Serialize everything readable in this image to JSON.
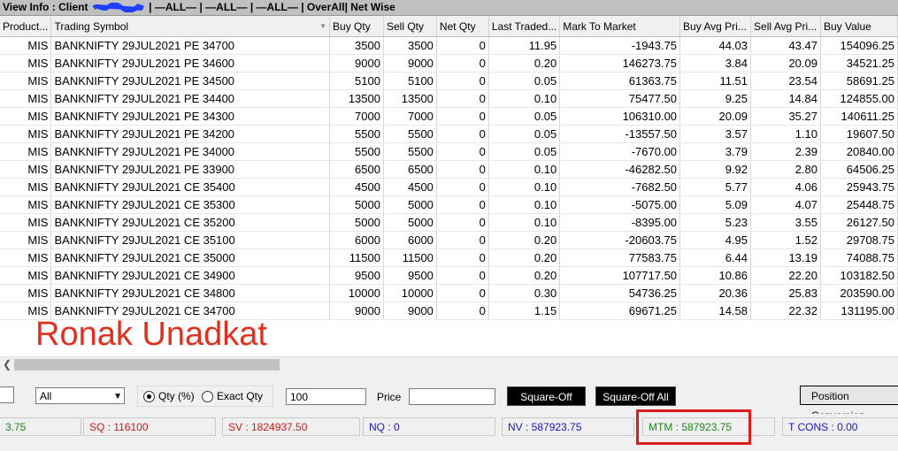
{
  "view_info": {
    "label": "View Info : Client",
    "rest": "| —ALL— | —ALL— | —ALL— | OverAll| Net Wise"
  },
  "columns": [
    "Product...",
    "Trading Symbol",
    "Buy Qty",
    "Sell Qty",
    "Net Qty",
    "Last Traded...",
    "Mark To Market",
    "Buy Avg Pri...",
    "Sell Avg Pri...",
    "Buy Value"
  ],
  "rows": [
    [
      "MIS",
      "BANKNIFTY 29JUL2021 PE 34700",
      "3500",
      "3500",
      "0",
      "11.95",
      "-1943.75",
      "44.03",
      "43.47",
      "154096.25"
    ],
    [
      "MIS",
      "BANKNIFTY 29JUL2021 PE 34600",
      "9000",
      "9000",
      "0",
      "0.20",
      "146273.75",
      "3.84",
      "20.09",
      "34521.25"
    ],
    [
      "MIS",
      "BANKNIFTY 29JUL2021 PE 34500",
      "5100",
      "5100",
      "0",
      "0.05",
      "61363.75",
      "11.51",
      "23.54",
      "58691.25"
    ],
    [
      "MIS",
      "BANKNIFTY 29JUL2021 PE 34400",
      "13500",
      "13500",
      "0",
      "0.10",
      "75477.50",
      "9.25",
      "14.84",
      "124855.00"
    ],
    [
      "MIS",
      "BANKNIFTY 29JUL2021 PE 34300",
      "7000",
      "7000",
      "0",
      "0.05",
      "106310.00",
      "20.09",
      "35.27",
      "140611.25"
    ],
    [
      "MIS",
      "BANKNIFTY 29JUL2021 PE 34200",
      "5500",
      "5500",
      "0",
      "0.05",
      "-13557.50",
      "3.57",
      "1.10",
      "19607.50"
    ],
    [
      "MIS",
      "BANKNIFTY 29JUL2021 PE 34000",
      "5500",
      "5500",
      "0",
      "0.05",
      "-7670.00",
      "3.79",
      "2.39",
      "20840.00"
    ],
    [
      "MIS",
      "BANKNIFTY 29JUL2021 PE 33900",
      "6500",
      "6500",
      "0",
      "0.10",
      "-46282.50",
      "9.92",
      "2.80",
      "64506.25"
    ],
    [
      "MIS",
      "BANKNIFTY 29JUL2021 CE 35400",
      "4500",
      "4500",
      "0",
      "0.10",
      "-7682.50",
      "5.77",
      "4.06",
      "25943.75"
    ],
    [
      "MIS",
      "BANKNIFTY 29JUL2021 CE 35300",
      "5000",
      "5000",
      "0",
      "0.10",
      "-5075.00",
      "5.09",
      "4.07",
      "25448.75"
    ],
    [
      "MIS",
      "BANKNIFTY 29JUL2021 CE 35200",
      "5000",
      "5000",
      "0",
      "0.10",
      "-8395.00",
      "5.23",
      "3.55",
      "26127.50"
    ],
    [
      "MIS",
      "BANKNIFTY 29JUL2021 CE 35100",
      "6000",
      "6000",
      "0",
      "0.20",
      "-20603.75",
      "4.95",
      "1.52",
      "29708.75"
    ],
    [
      "MIS",
      "BANKNIFTY 29JUL2021 CE 35000",
      "11500",
      "11500",
      "0",
      "0.20",
      "77583.75",
      "6.44",
      "13.19",
      "74088.75"
    ],
    [
      "MIS",
      "BANKNIFTY 29JUL2021 CE 34900",
      "9500",
      "9500",
      "0",
      "0.20",
      "107717.50",
      "10.86",
      "22.20",
      "103182.50"
    ],
    [
      "MIS",
      "BANKNIFTY 29JUL2021 CE 34800",
      "10000",
      "10000",
      "0",
      "0.30",
      "54736.25",
      "20.36",
      "25.83",
      "203590.00"
    ],
    [
      "MIS",
      "BANKNIFTY 29JUL2021 CE 34700",
      "9000",
      "9000",
      "0",
      "1.15",
      "69671.25",
      "14.58",
      "22.32",
      "131195.00"
    ]
  ],
  "watermark": "Ronak Unadkat",
  "controls": {
    "filter_value": "All",
    "radio_qty_pct": "Qty (%)",
    "radio_exact_qty": "Exact Qty",
    "qty_value": "100",
    "price_label": "Price",
    "price_value": "",
    "square_off": "Square-Off",
    "square_off_all": "Square-Off All",
    "position_conversion": "Position Conversion"
  },
  "status": {
    "first": "3.75",
    "sq": "SQ : 116100",
    "sv": "SV : 1824937.50",
    "nq": "NQ : 0",
    "nv": "NV : 587923.75",
    "mtm": "MTM : 587923.75",
    "tcons": "T CONS : 0.00"
  },
  "colors": {
    "status_green": "#1a8a1a",
    "status_red": "#d01818",
    "status_blue": "#1818c8",
    "highlight": "#e01b1b",
    "watermark": "#e0301e",
    "scribble": "#1f3fff"
  }
}
